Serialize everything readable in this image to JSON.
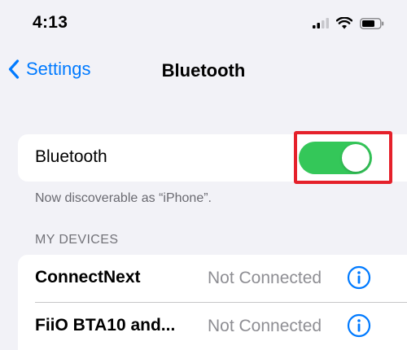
{
  "status_bar": {
    "time": "4:13",
    "icons": [
      "cellular-signal-icon",
      "wifi-icon",
      "battery-icon"
    ]
  },
  "nav": {
    "back_label": "Settings",
    "title": "Bluetooth"
  },
  "bluetooth_row": {
    "label": "Bluetooth",
    "toggle_on": true,
    "toggle_color": "#34c759",
    "highlight_color": "#e5212b"
  },
  "discoverable_text": "Now discoverable as “iPhone”.",
  "my_devices": {
    "header": "MY DEVICES",
    "devices": [
      {
        "name": "ConnectNext",
        "status": "Not Connected"
      },
      {
        "name": "FiiO BTA10 and...",
        "status": "Not Connected"
      }
    ]
  },
  "accent_color": "#007aff"
}
